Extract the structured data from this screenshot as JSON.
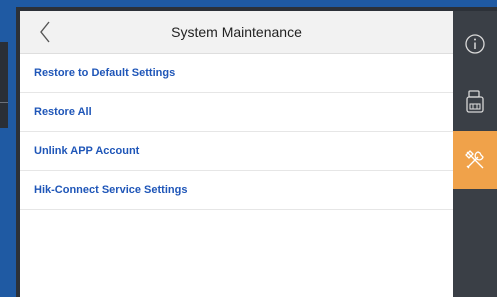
{
  "header": {
    "title": "System Maintenance"
  },
  "menu": {
    "items": [
      {
        "label": "Restore to Default Settings"
      },
      {
        "label": "Restore All"
      },
      {
        "label": "Unlink APP Account"
      },
      {
        "label": "Hik-Connect Service Settings"
      }
    ]
  },
  "sidebar": {
    "buttons": [
      {
        "icon": "info-icon",
        "active": false
      },
      {
        "icon": "device-icon",
        "active": false
      },
      {
        "icon": "tools-icon",
        "active": true
      }
    ],
    "active_color": "#f0a24a"
  },
  "colors": {
    "link_text": "#1f56b8",
    "background": "#1f5aa3"
  }
}
